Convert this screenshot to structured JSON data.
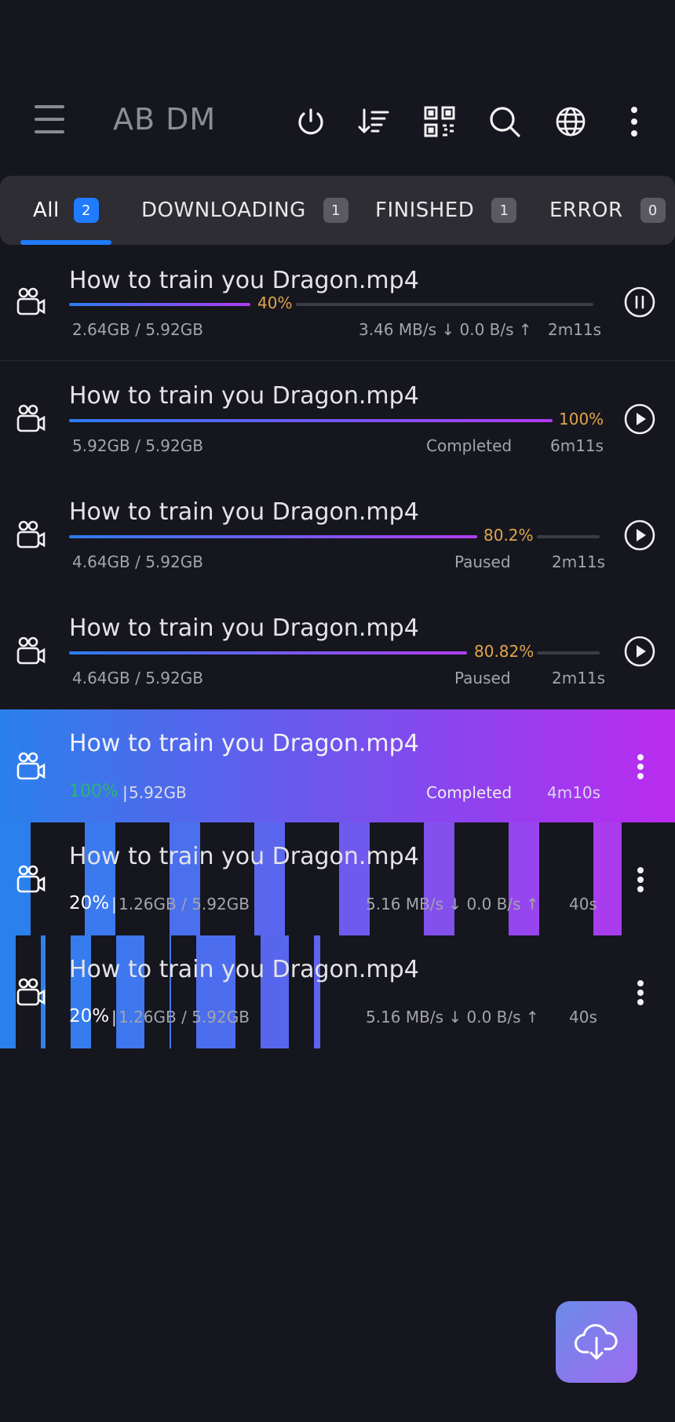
{
  "app_title": "AB DM",
  "tabs": [
    {
      "label": "All",
      "count": "2"
    },
    {
      "label": "DOWNLOADING",
      "count": "1"
    },
    {
      "label": "FINISHED",
      "count": "1"
    },
    {
      "label": "ERROR",
      "count": "0"
    }
  ],
  "downloads": [
    {
      "name": "How to train you Dragon.mp4",
      "progress_text": "40%",
      "progress": 0.4,
      "size": "2.64GB / 5.92GB",
      "status": "3.46 MB/s ↓ 0.0 B/s ↑",
      "time": "2m11s",
      "action": "pause"
    },
    {
      "name": "How to train you Dragon.mp4",
      "progress_text": "100%",
      "progress": 1.0,
      "size": "5.92GB / 5.92GB",
      "status": "Completed",
      "time": "6m11s",
      "action": "play"
    },
    {
      "name": "How to train you Dragon.mp4",
      "progress_text": "80.2%",
      "progress": 0.802,
      "size": "4.64GB / 5.92GB",
      "status": "Paused",
      "time": "2m11s",
      "action": "play"
    },
    {
      "name": "How to train you Dragon.mp4",
      "progress_text": "80.82%",
      "progress": 0.8082,
      "size": "4.64GB / 5.92GB",
      "status": "Paused",
      "time": "2m11s",
      "action": "play"
    },
    {
      "name": "How to train you Dragon.mp4",
      "pct": "100%",
      "size": "5.92GB",
      "status": "Completed",
      "time": "4m10s"
    },
    {
      "name": "How to train you Dragon.mp4",
      "pct": "20%",
      "size": "1.26GB / 5.92GB",
      "status": "5.16 MB/s ↓ 0.0 B/s ↑",
      "time": "40s"
    },
    {
      "name": "How to train you Dragon.mp4",
      "pct": "20%",
      "size": "1.26GB / 5.92GB",
      "status": "5.16 MB/s ↓ 0.0 B/s ↑",
      "time": "40s"
    }
  ],
  "colors": {
    "accent": "#1f7bff",
    "progress_start": "#2d7cf0",
    "progress_end": "#b13cf0",
    "percent": "#e0a54c",
    "success": "#2bb673"
  },
  "icons": {
    "menu": "menu-icon",
    "power": "power-icon",
    "sort": "sort-icon",
    "qr": "qr-code-icon",
    "search": "search-icon",
    "browser": "globe-icon",
    "more": "more-vertical-icon",
    "file": "video-camera-icon",
    "fab": "cloud-download-icon"
  }
}
